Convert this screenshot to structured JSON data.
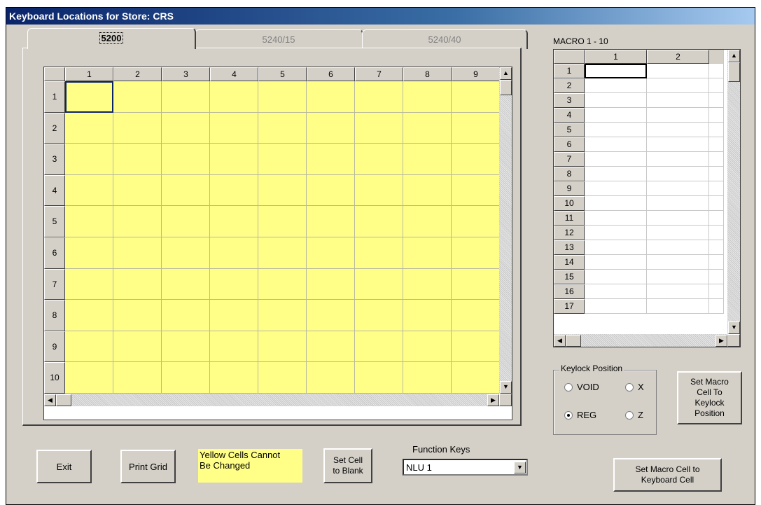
{
  "window": {
    "title": "Keyboard Locations for Store: CRS"
  },
  "tabs": [
    {
      "label": "5200",
      "active": true
    },
    {
      "label": "5240/15",
      "active": false
    },
    {
      "label": "5240/40",
      "active": false
    }
  ],
  "main_grid": {
    "columns": [
      "1",
      "2",
      "3",
      "4",
      "5",
      "6",
      "7",
      "8",
      "9"
    ],
    "rows": [
      "1",
      "2",
      "3",
      "4",
      "5",
      "6",
      "7",
      "8",
      "9",
      "10"
    ],
    "cell_color": "#ffff88"
  },
  "macro": {
    "label": "MACRO 1 - 10",
    "columns": [
      "1",
      "2"
    ],
    "rows": [
      "1",
      "2",
      "3",
      "4",
      "5",
      "6",
      "7",
      "8",
      "9",
      "10",
      "11",
      "12",
      "13",
      "14",
      "15",
      "16",
      "17"
    ]
  },
  "keylock": {
    "legend": "Keylock Position",
    "options": [
      {
        "label": "VOID",
        "selected": false
      },
      {
        "label": "X",
        "selected": false
      },
      {
        "label": "REG",
        "selected": true
      },
      {
        "label": "Z",
        "selected": false
      }
    ]
  },
  "buttons": {
    "exit": "Exit",
    "print_grid": "Print Grid",
    "set_blank": "Set Cell\nto Blank",
    "set_keylock": "Set Macro\nCell To\nKeylock\nPosition",
    "set_keyboard": "Set Macro Cell to\nKeyboard Cell"
  },
  "note": "Yellow Cells Cannot\nBe Changed",
  "function_keys": {
    "label": "Function Keys",
    "value": "NLU 1"
  }
}
